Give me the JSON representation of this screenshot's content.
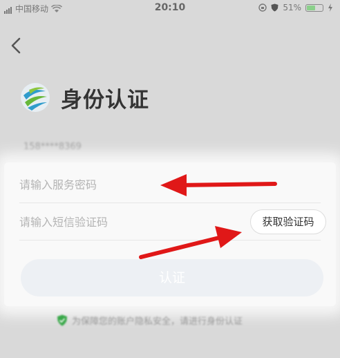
{
  "status_bar": {
    "carrier": "中国移动",
    "time": "20:10",
    "battery": "51%",
    "icons": [
      "signal-icon",
      "wifi-icon",
      "lock-rotation-icon",
      "shield-icon",
      "battery-icon",
      "charging-icon"
    ]
  },
  "header": {
    "back_icon": "chevron-left-icon",
    "title": "身份认证",
    "logo": "china-mobile-logo"
  },
  "account": {
    "masked_phone": "158****8369"
  },
  "form": {
    "password_placeholder": "请输入服务密码",
    "sms_placeholder": "请输入短信验证码",
    "get_code_label": "获取验证码",
    "submit_label": "认证"
  },
  "footer": {
    "note": "为保障您的账户隐私安全，请进行身份认证",
    "icon": "green-shield-icon"
  },
  "annotations": {
    "arrow_color": "#e01818"
  }
}
